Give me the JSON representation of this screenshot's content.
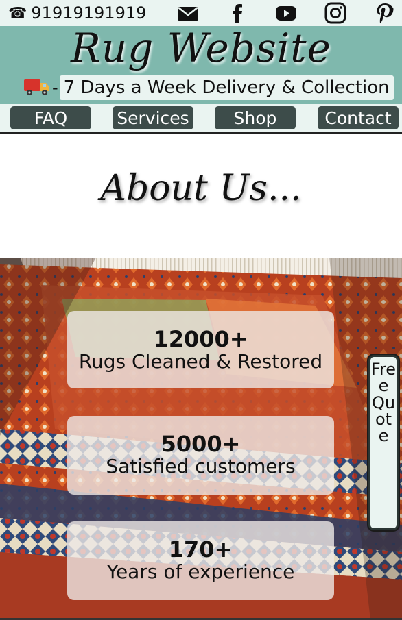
{
  "topbar": {
    "phone_icon": "☎",
    "phone": "91919191919",
    "social_icons": [
      "mail-icon",
      "facebook-icon",
      "youtube-icon",
      "instagram-icon",
      "pinterest-icon"
    ]
  },
  "header": {
    "title": "Rug Website",
    "delivery_icon": "delivery-truck-icon",
    "delivery_dash": "-",
    "delivery_text": "7 Days a Week Delivery & Collection"
  },
  "nav": {
    "items": [
      {
        "label": "FAQ"
      },
      {
        "label": "Services"
      },
      {
        "label": "Shop"
      },
      {
        "label": "Contact"
      }
    ]
  },
  "about": {
    "heading": "About Us..."
  },
  "stats": [
    {
      "number": "12000+",
      "label": "Rugs Cleaned & Restored"
    },
    {
      "number": "5000+",
      "label": "Satisfied customers"
    },
    {
      "number": "170+",
      "label": "Years of experience"
    }
  ],
  "quote_tab": {
    "label": "Free Quote"
  },
  "colors": {
    "header_bg": "#7fb8ad",
    "strip_bg": "#eaf4f1",
    "nav_button": "#3d4c4a"
  }
}
